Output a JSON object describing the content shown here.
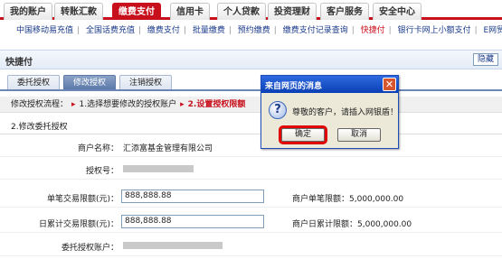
{
  "topnav": {
    "tabs": [
      "我的账户",
      "转账汇款",
      "缴费支付",
      "信用卡",
      "个人贷款",
      "投资理财",
      "客户服务",
      "安全中心"
    ],
    "active_index": 2
  },
  "subnav": {
    "items": [
      "中国移动易充值",
      "全国话费充值",
      "缴费支付",
      "批量缴费",
      "预约缴费",
      "缴费支付记录查询",
      "快捷付",
      "银行卡网上小额支付",
      "E网贸通"
    ],
    "highlight_index": 6
  },
  "header": {
    "title": "快捷付",
    "hide_label": "隐藏"
  },
  "subtabs": [
    "委托授权",
    "修改授权",
    "注销授权"
  ],
  "steps": {
    "label": "修改授权流程：",
    "step1": "1.选择想要修改的授权账户",
    "step2": "2.设置授权限额"
  },
  "section_title": "2.修改委托授权",
  "form": {
    "merchant_label": "商户名称：",
    "merchant_value": "汇添富基金管理有限公司",
    "auth_no_label": "授权号：",
    "single_label": "单笔交易限额(元)：",
    "single_value": "888,888.88",
    "single_note": "商户单笔限额：5,000,000.00",
    "daily_label": "日累计交易限额(元)：",
    "daily_value": "888,888.88",
    "daily_note": "商户日累计限额：5,000,000.00",
    "account_label": "委托授权账户："
  },
  "dialog": {
    "title": "来自网页的消息",
    "message": "尊敬的客户，请插入网银盾！",
    "ok_label": "确定",
    "cancel_label": "取消",
    "close_symbol": "✕",
    "icon_symbol": "?"
  }
}
